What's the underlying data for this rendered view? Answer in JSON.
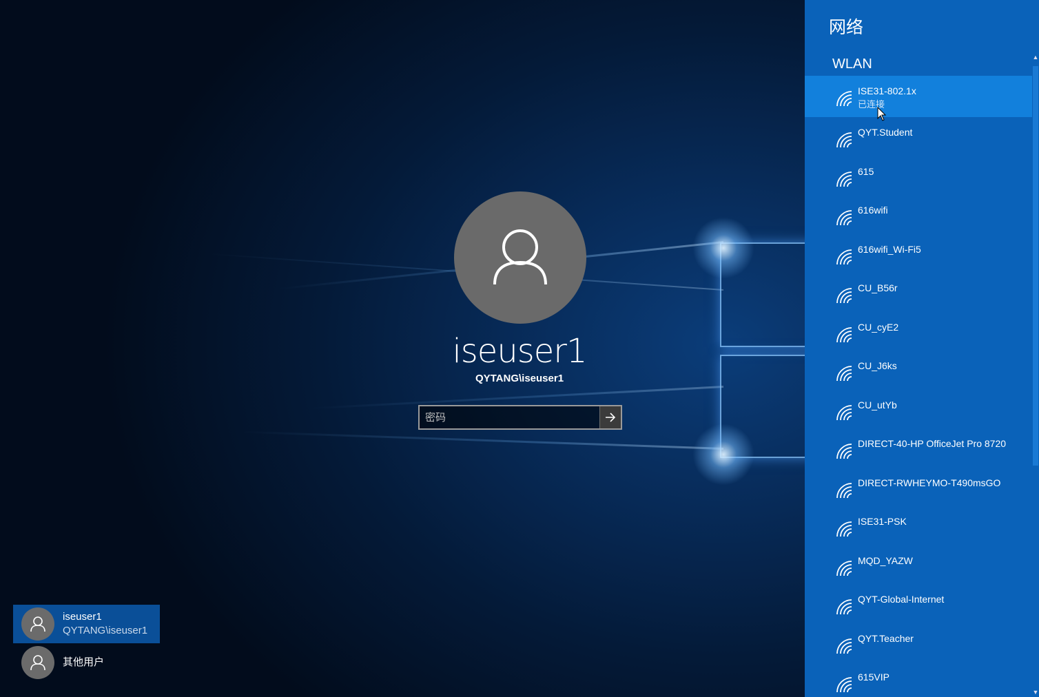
{
  "login": {
    "username": "iseuser1",
    "domain_user": "QYTANG\\iseuser1",
    "password_placeholder": "密码"
  },
  "user_switcher": [
    {
      "name": "iseuser1",
      "sub": "QYTANG\\iseuser1",
      "selected": true
    },
    {
      "name": "其他用户",
      "sub": "",
      "selected": false
    }
  ],
  "network_panel": {
    "title": "网络",
    "section": "WLAN",
    "networks": [
      {
        "name": "ISE31-802.1x",
        "status": "已连接",
        "active": true
      },
      {
        "name": "QYT.Student"
      },
      {
        "name": "615"
      },
      {
        "name": "616wifi"
      },
      {
        "name": "616wifi_Wi-Fi5"
      },
      {
        "name": "CU_B56r"
      },
      {
        "name": "CU_cyE2"
      },
      {
        "name": "CU_J6ks"
      },
      {
        "name": "CU_utYb"
      },
      {
        "name": "DIRECT-40-HP OfficeJet Pro 8720"
      },
      {
        "name": "DIRECT-RWHEYMO-T490msGO"
      },
      {
        "name": "ISE31-PSK"
      },
      {
        "name": "MQD_YAZW"
      },
      {
        "name": "QYT-Global-Internet"
      },
      {
        "name": "QYT.Teacher"
      },
      {
        "name": "615VIP"
      }
    ]
  },
  "colors": {
    "panel_bg": "#0a62b9",
    "panel_active": "#1280dc",
    "selected_user": "#0a4f98"
  }
}
